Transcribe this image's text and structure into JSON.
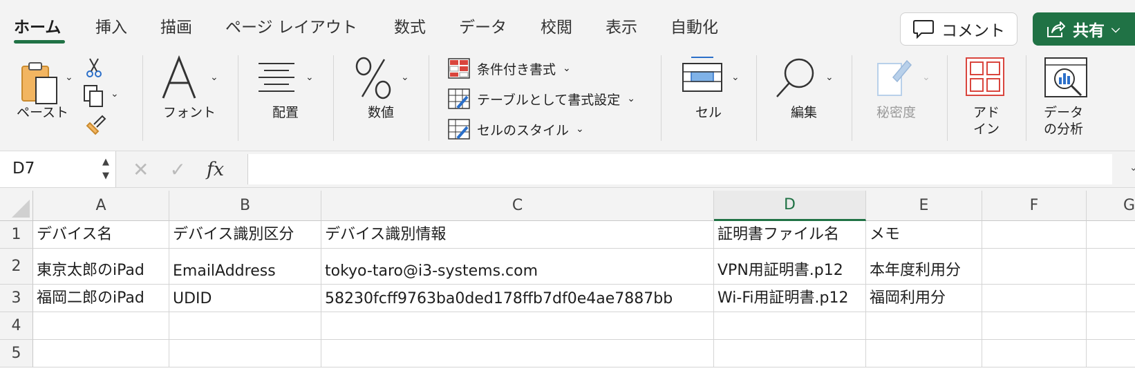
{
  "tabs": [
    {
      "label": "ホーム",
      "active": true
    },
    {
      "label": "挿入"
    },
    {
      "label": "描画"
    },
    {
      "label": "ページ レイアウト"
    },
    {
      "label": "数式"
    },
    {
      "label": "データ"
    },
    {
      "label": "校閲"
    },
    {
      "label": "表示"
    },
    {
      "label": "自動化"
    }
  ],
  "header": {
    "comment_label": "コメント",
    "share_label": "共有"
  },
  "ribbon": {
    "paste": "ペースト",
    "font": "フォント",
    "align": "配置",
    "number": "数値",
    "cond_format": "条件付き書式",
    "table_format": "テーブルとして書式設定",
    "cell_style": "セルのスタイル",
    "cells": "セル",
    "edit": "編集",
    "sensitivity": "秘密度",
    "addin_1": "アド",
    "addin_2": "イン",
    "analyze_1": "データ",
    "analyze_2": "の分析"
  },
  "formula_bar": {
    "name_box": "D7",
    "formula": ""
  },
  "colors": {
    "accent": "#207245",
    "grid_line": "#d4d4d4",
    "header_bg": "#f3f3f3"
  },
  "columns": [
    "A",
    "B",
    "C",
    "D",
    "E",
    "F",
    "G"
  ],
  "selected_column": "D",
  "rows": [
    {
      "num": "1",
      "cells": [
        "デバイス名",
        "デバイス識別区分",
        "デバイス識別情報",
        "証明書ファイル名",
        "メモ",
        "",
        ""
      ]
    },
    {
      "num": "2",
      "cells": [
        "東京太郎のiPad",
        "EmailAddress",
        "tokyo-taro@i3-systems.com",
        "VPN用証明書.p12",
        "本年度利用分",
        "",
        ""
      ]
    },
    {
      "num": "3",
      "cells": [
        "福岡二郎のiPad",
        "UDID",
        "58230fcff9763ba0ded178ffb7df0e4ae7887bb",
        "Wi-Fi用証明書.p12",
        "福岡利用分",
        "",
        ""
      ]
    },
    {
      "num": "4",
      "cells": [
        "",
        "",
        "",
        "",
        "",
        "",
        ""
      ]
    },
    {
      "num": "5",
      "cells": [
        "",
        "",
        "",
        "",
        "",
        "",
        ""
      ]
    }
  ]
}
